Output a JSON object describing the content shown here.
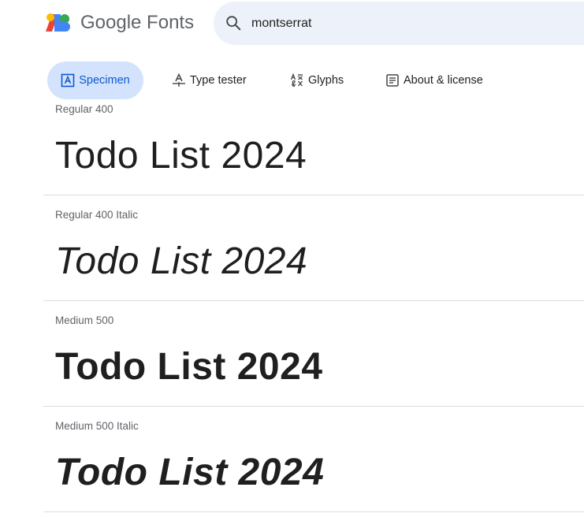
{
  "header": {
    "brand": "Google Fonts",
    "search": {
      "value": "montserrat",
      "placeholder": ""
    }
  },
  "tabs": [
    {
      "label": "Specimen",
      "icon": "specimen-icon",
      "active": true
    },
    {
      "label": "Type tester",
      "icon": "type-tester-icon",
      "active": false
    },
    {
      "label": "Glyphs",
      "icon": "glyphs-icon",
      "active": false
    },
    {
      "label": "About & license",
      "icon": "about-icon",
      "active": false
    }
  ],
  "styles": [
    {
      "name": "Regular 400",
      "sample": "Todo List 2024"
    },
    {
      "name": "Regular 400 Italic",
      "sample": "Todo List 2024"
    },
    {
      "name": "Medium 500",
      "sample": "Todo List 2024"
    },
    {
      "name": "Medium 500 Italic",
      "sample": "Todo List 2024"
    }
  ],
  "colors": {
    "accent": "#0b57d0",
    "active_tab_bg": "#d3e3fd",
    "search_bg": "#edf2fa",
    "logo_blue": "#4285f4",
    "logo_red": "#ea4335",
    "logo_yellow": "#fbbc04",
    "logo_green": "#34a853"
  }
}
